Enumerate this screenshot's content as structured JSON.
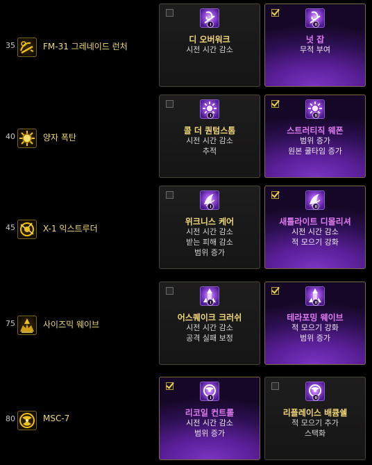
{
  "skills": [
    {
      "level": "35",
      "icon": "grenade-launcher-icon",
      "name": "FM-31 그레네이드 런처",
      "runes": [
        {
          "title": "디 오버워크",
          "selected": false,
          "rune_icon": "spiral-rune-icon",
          "numeral": "I",
          "effects": [
            "시전 시간 감소"
          ]
        },
        {
          "title": "넛 잡",
          "selected": true,
          "rune_icon": "spiral-rune-icon",
          "numeral": "II",
          "effects": [
            "무적 부여"
          ]
        }
      ]
    },
    {
      "level": "40",
      "icon": "quantum-bomb-icon",
      "name": "양자 폭탄",
      "runes": [
        {
          "title": "콜 더 퀀텀스톰",
          "selected": false,
          "rune_icon": "sun-rune-icon",
          "numeral": "I",
          "effects": [
            "시전 시간 감소",
            "추적"
          ]
        },
        {
          "title": "스트러티직 웨폰",
          "selected": true,
          "rune_icon": "sun-rune-icon",
          "numeral": "II",
          "effects": [
            "범위 증가",
            "원본 쿨타임 증가"
          ]
        }
      ]
    },
    {
      "level": "45",
      "icon": "x1-extruder-icon",
      "name": "X-1 익스트루더",
      "runes": [
        {
          "title": "위크니스 케어",
          "selected": false,
          "rune_icon": "claw-rune-icon",
          "numeral": "I",
          "effects": [
            "시전 시간 감소",
            "받는 피해 감소",
            "범위 증가"
          ]
        },
        {
          "title": "새틀라이트 디몰리셔",
          "selected": true,
          "rune_icon": "claw-rune-icon",
          "numeral": "II",
          "effects": [
            "시전 시간 감소",
            "적 모으기 강화"
          ]
        }
      ]
    },
    {
      "level": "75",
      "icon": "seismic-wave-icon",
      "name": "사이즈믹 웨이브",
      "runes": [
        {
          "title": "어스퀘이크 크러쉬",
          "selected": false,
          "rune_icon": "pillar-rune-icon",
          "numeral": "I",
          "effects": [
            "시전 시간 감소",
            "공격 실패 보정"
          ]
        },
        {
          "title": "테라포밍 웨이브",
          "selected": true,
          "rune_icon": "pillar-rune-icon",
          "numeral": "II",
          "effects": [
            "적 모으기 강화",
            "범위 증가"
          ]
        }
      ]
    },
    {
      "level": "80",
      "icon": "msc7-icon",
      "name": "MSC-7",
      "runes": [
        {
          "title": "리코일 컨트롤",
          "selected": true,
          "rune_icon": "orb-rune-icon",
          "numeral": "I",
          "effects": [
            "시전 시간 감소",
            "범위 증가"
          ]
        },
        {
          "title": "리플레이스 배큠쉘",
          "selected": false,
          "rune_icon": "orb-rune-icon",
          "numeral": "II",
          "effects": [
            "적 모으기 추가",
            "스택화"
          ]
        }
      ]
    }
  ]
}
